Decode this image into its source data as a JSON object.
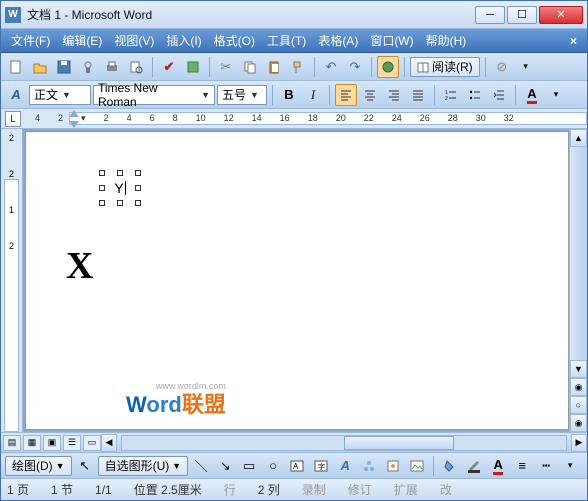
{
  "title": "文档 1 - Microsoft Word",
  "menu": {
    "file": "文件(F)",
    "edit": "编辑(E)",
    "view": "视图(V)",
    "insert": "插入(I)",
    "format": "格式(O)",
    "tools": "工具(T)",
    "table": "表格(A)",
    "window": "窗口(W)",
    "help": "帮助(H)"
  },
  "toolbar2": {
    "style_icon": "A",
    "style": "正文",
    "font": "Times New Roman",
    "size": "五号",
    "read_label": "阅读(R)"
  },
  "ruler_h": [
    "4",
    "2",
    "2",
    "4",
    "6",
    "8",
    "10",
    "12",
    "14",
    "16",
    "18",
    "20",
    "22",
    "24",
    "26",
    "28",
    "30",
    "32"
  ],
  "ruler_v": [
    "2",
    "",
    "2",
    "",
    "1",
    "",
    "2"
  ],
  "document": {
    "main_char": "X",
    "textbox_char": "Y"
  },
  "watermark": {
    "w": "W",
    "ord": "ord",
    "lm": "联盟",
    "url": "www.wordlm.com"
  },
  "drawbar": {
    "draw_label": "绘图(D)",
    "autoshapes": "自选图形(U)"
  },
  "status": {
    "page": "1 页",
    "sec": "1 节",
    "pageof": "1/1",
    "pos": "位置 2.5厘米",
    "line": "行",
    "col": "2 列",
    "rec": "录制",
    "rev": "修订",
    "ext": "扩展",
    "ovr": "改"
  }
}
